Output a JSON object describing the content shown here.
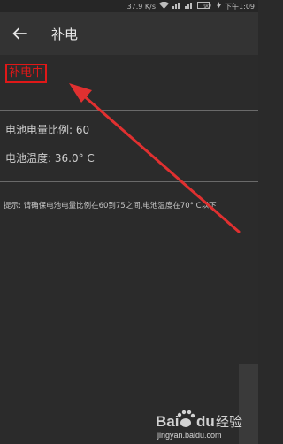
{
  "status_bar": {
    "speed": "37.9 K/s",
    "battery": "90",
    "time": "下午1:09"
  },
  "app_bar": {
    "title": "补电"
  },
  "charging_status": "补电中",
  "battery_ratio": {
    "label": "电池电量比例:",
    "value": "60"
  },
  "battery_temp": {
    "label": "电池温度:",
    "value": "36.0° C"
  },
  "tip": "提示: 请确保电池电量比例在60到75之间,电池温度在70° C以下",
  "watermark": {
    "brand": "Baidu经验",
    "url": "jingyan.baidu.com"
  },
  "colors": {
    "background": "#2b2b2b",
    "app_bar": "#333333",
    "highlight": "#e01818"
  }
}
